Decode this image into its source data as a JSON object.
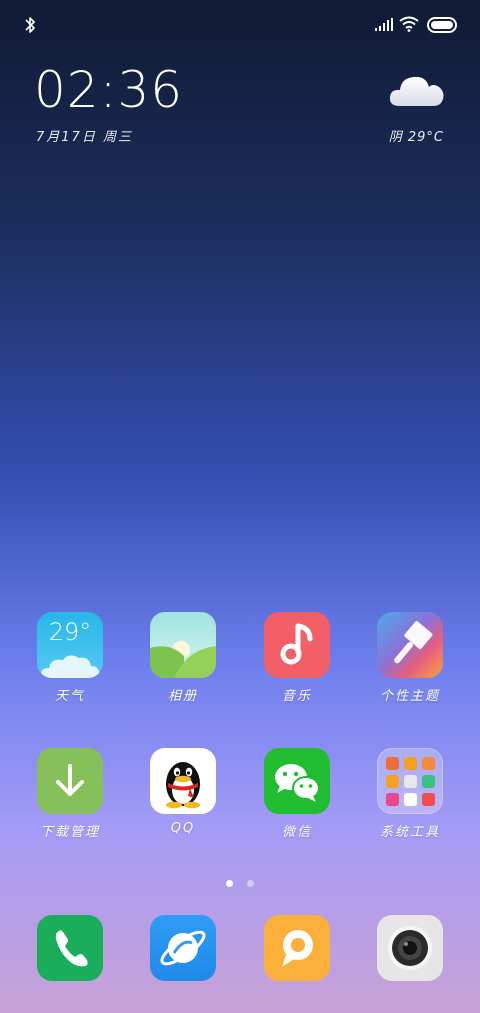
{
  "status_bar": {
    "bluetooth_icon": "bluetooth-icon",
    "signal_icon": "signal-icon",
    "wifi_icon": "wifi-icon",
    "battery_icon": "battery-icon",
    "battery_level": 1.0
  },
  "lockscreen_widget": {
    "time": "02:36",
    "date": "7月17日 周三",
    "weather_icon": "cloud-icon",
    "weather": "阴  29°C"
  },
  "apps_row1": [
    {
      "label": "天气",
      "icon": "weather-icon",
      "badge_text": "29°"
    },
    {
      "label": "相册",
      "icon": "gallery-icon"
    },
    {
      "label": "音乐",
      "icon": "music-icon"
    },
    {
      "label": "个性主题",
      "icon": "theme-icon"
    }
  ],
  "apps_row2": [
    {
      "label": "下载管理",
      "icon": "download-icon"
    },
    {
      "label": "QQ",
      "icon": "qq-icon"
    },
    {
      "label": "微信",
      "icon": "wechat-icon"
    },
    {
      "label": "系统工具",
      "icon": "folder-icon"
    }
  ],
  "page_indicator": {
    "pages": 2,
    "active": 1
  },
  "dock": [
    {
      "icon": "phone-icon"
    },
    {
      "icon": "browser-icon"
    },
    {
      "icon": "message-icon"
    },
    {
      "icon": "camera-icon"
    }
  ],
  "colors": {
    "music": "#f35f66",
    "download": "#86c05b",
    "wechat": "#1fbd2f",
    "phone": "#1aae5b",
    "browser": "#2f9cf6",
    "message": "#fbb03b"
  }
}
